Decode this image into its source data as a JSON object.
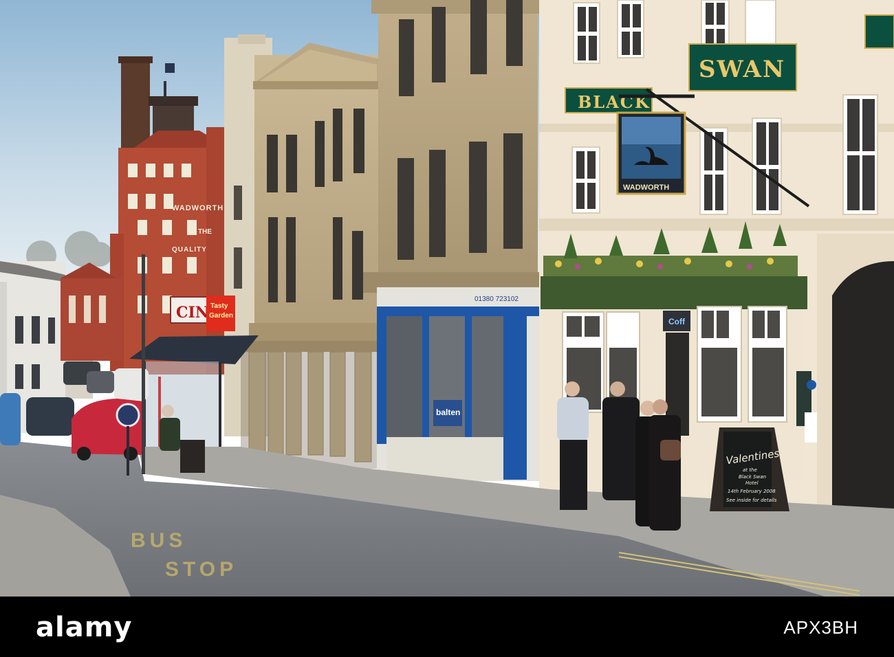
{
  "scene": {
    "signs": {
      "pub_word_1": "BLACK",
      "pub_word_2": "SWAN",
      "hanging_sign": "WADWORTH",
      "brewery_name": "WADWORTH",
      "brewery_line_2": "THE",
      "brewery_line_3": "QUALITY",
      "cinema_fragment": "CIN",
      "takeaway_line_1": "Tasty",
      "takeaway_line_2": "Garden",
      "agent_phone": "01380 723102",
      "window_poster": "balten",
      "side_window": "Coff",
      "road_marking_1": "BUS",
      "road_marking_2": "STOP"
    },
    "chalkboard": {
      "line_1": "Valentines",
      "line_2": "at the",
      "line_3": "Black Swan",
      "line_4": "Hotel",
      "line_5": "14th February 2008",
      "line_6": "See inside for details"
    }
  },
  "stock": {
    "logo": "alamy",
    "image_id": "APX3BH"
  }
}
